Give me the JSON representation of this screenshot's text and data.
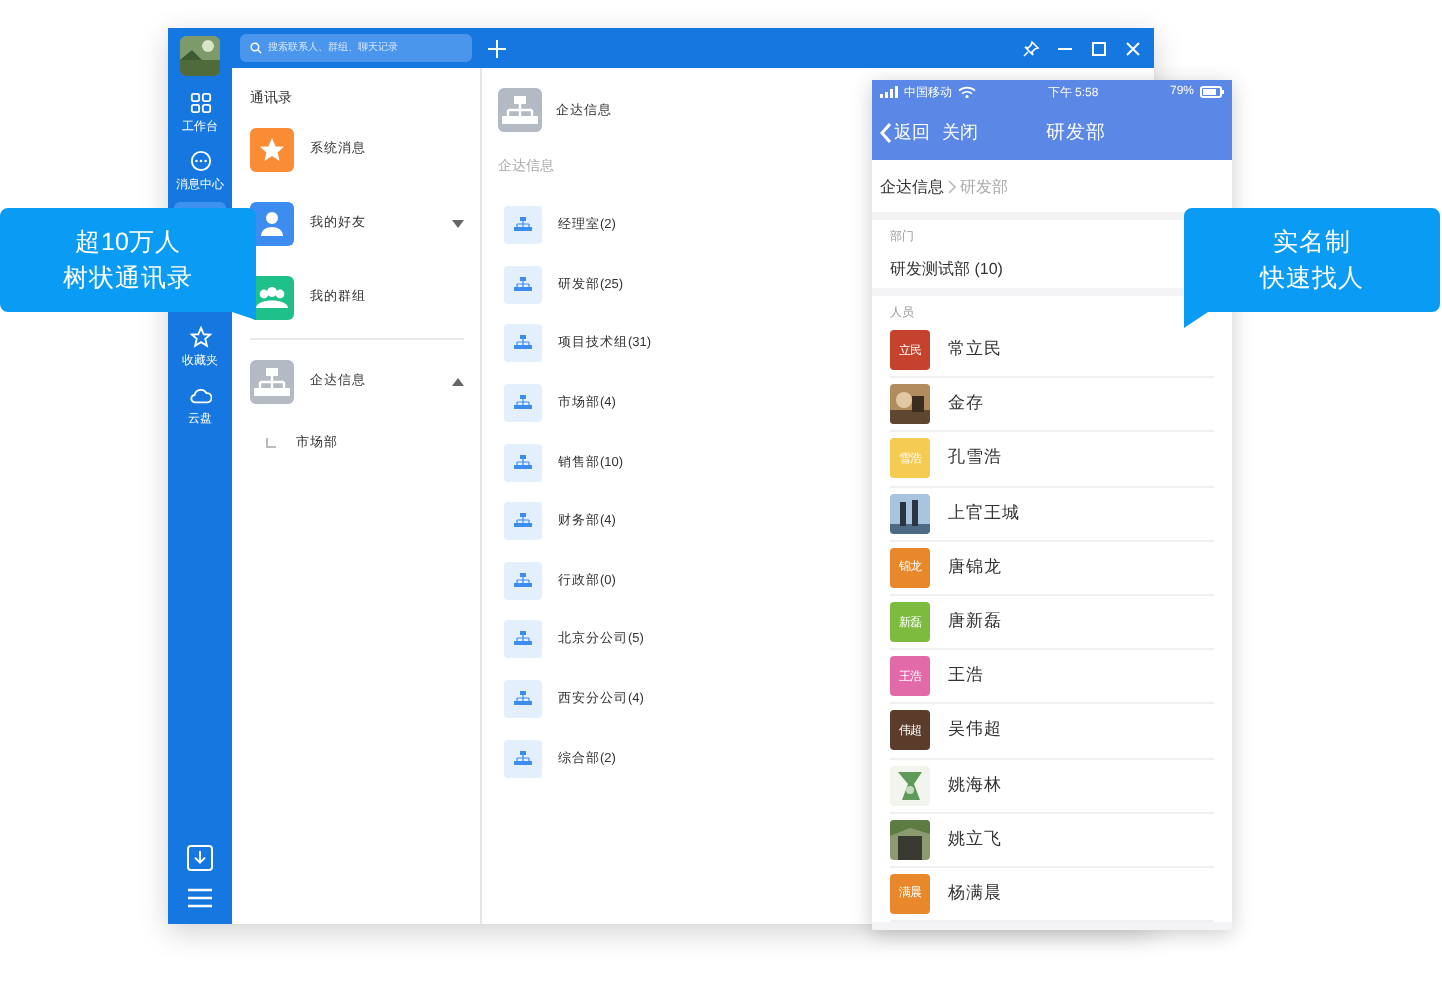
{
  "desktop": {
    "rail": {
      "items": [
        {
          "kind": "grid",
          "label": "工作台",
          "selected": false
        },
        {
          "kind": "chat",
          "label": "消息中心",
          "selected": false
        },
        {
          "selected": true
        },
        {
          "kind": "star",
          "label": "收藏夹",
          "selected": false
        },
        {
          "kind": "cloud",
          "label": "云盘",
          "selected": false
        }
      ]
    },
    "search": {
      "placeholder": "搜索联系人、群组、聊天记录"
    },
    "contacts": {
      "title": "通讯录",
      "items": [
        {
          "kind": "star",
          "label": "系统消息",
          "color": "#fa8c35"
        },
        {
          "kind": "person",
          "label": "我的好友",
          "color": "#3d8cf0",
          "expanded": false
        },
        {
          "kind": "group",
          "label": "我的群组",
          "color": "#20c08a"
        },
        {
          "kind": "org",
          "label": "企达信息",
          "color": "#b4bac4",
          "expanded": true,
          "children": [
            {
              "label": "市场部"
            }
          ]
        }
      ]
    },
    "org": {
      "header": "企达信息",
      "section": "企达信息",
      "departments": [
        "经理室(2)",
        "研发部(25)",
        "项目技术组(31)",
        "市场部(4)",
        "销售部(10)",
        "财务部(4)",
        "行政部(0)",
        "北京分公司(5)",
        "西安分公司(4)",
        "综合部(2)"
      ]
    }
  },
  "phone": {
    "status": {
      "carrier": "中国移动",
      "time": "下午 5:58",
      "battery": "79%"
    },
    "nav": {
      "back": "返回",
      "close": "关闭",
      "title": "研发部"
    },
    "breadcrumb": [
      "企达信息",
      "研发部"
    ],
    "dept_section": "部门",
    "department": "研发测试部 (10)",
    "people_section": "人员",
    "people": [
      {
        "name": "常立民",
        "kind": "initials",
        "initials": "立民",
        "color": "#c5432c"
      },
      {
        "name": "金存"
      },
      {
        "name": "孔雪浩",
        "kind": "initials",
        "initials": "雪浩",
        "color": "#f6cb52"
      },
      {
        "name": "上官王城"
      },
      {
        "name": "唐锦龙",
        "kind": "initials",
        "initials": "锦龙",
        "color": "#e9872b"
      },
      {
        "name": "唐新磊",
        "kind": "initials",
        "initials": "新磊",
        "color": "#7dbb3e"
      },
      {
        "name": "王浩",
        "kind": "initials",
        "initials": "王浩",
        "color": "#e26aa9"
      },
      {
        "name": "吴伟超",
        "kind": "initials",
        "initials": "伟超",
        "color": "#5b3c2b"
      },
      {
        "name": "姚海林"
      },
      {
        "name": "姚立飞"
      },
      {
        "name": "杨满晨",
        "kind": "initials",
        "initials": "满晨",
        "color": "#e9872b"
      }
    ]
  },
  "callouts": [
    {
      "kind": "tail-right",
      "lines": [
        "超10万人",
        "树状通讯录"
      ]
    },
    {
      "kind": "tail-left",
      "lines": [
        "实名制",
        "快速找人"
      ]
    }
  ]
}
